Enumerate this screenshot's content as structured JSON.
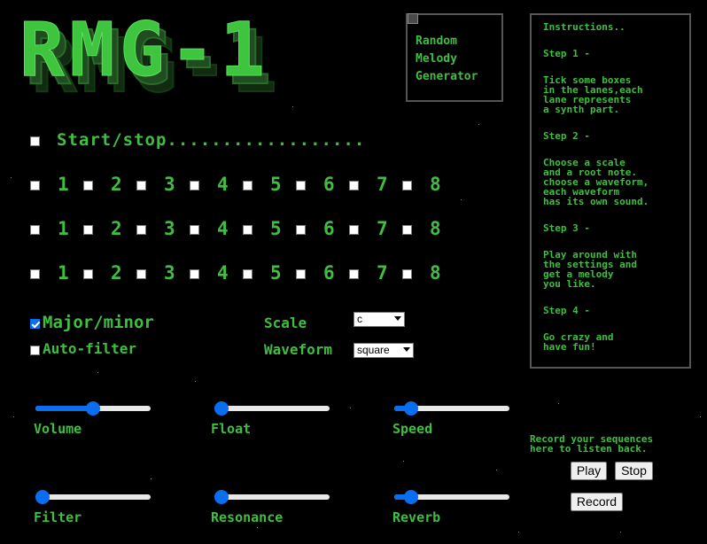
{
  "logo": {
    "text": "RMG-1"
  },
  "title_box": {
    "line1": "Random",
    "line2": "Melody",
    "line3": "Generator"
  },
  "instructions": {
    "heading": "Instructions..",
    "step1_title": "Step 1 -",
    "step1_text": "Tick some boxes\nin the lanes,each\nlane represents\na synth part.",
    "step2_title": "Step 2 -",
    "step2_text": "Choose a scale\nand a root note.\nchoose a waveform,\neach waveform\nhas its own sound.",
    "step3_title": "Step 3 -",
    "step3_text": "Play around with\nthe settings and\nget a melody\nyou like.",
    "step4_title": "Step 4 -",
    "step4_text": "Go crazy and\nhave fun!"
  },
  "start_stop": {
    "label": "Start/stop..................",
    "checked": false
  },
  "lanes": [
    {
      "steps": [
        "1",
        "2",
        "3",
        "4",
        "5",
        "6",
        "7",
        "8"
      ]
    },
    {
      "steps": [
        "1",
        "2",
        "3",
        "4",
        "5",
        "6",
        "7",
        "8"
      ]
    },
    {
      "steps": [
        "1",
        "2",
        "3",
        "4",
        "5",
        "6",
        "7",
        "8"
      ]
    }
  ],
  "options": {
    "major_minor": {
      "label": "Major/minor",
      "checked": true
    },
    "auto_filter": {
      "label": "Auto-filter",
      "checked": false
    },
    "scale": {
      "label": "Scale",
      "value": "c"
    },
    "waveform": {
      "label": "Waveform",
      "value": "square"
    }
  },
  "sliders": {
    "volume": {
      "label": "Volume",
      "value": 0.5
    },
    "float": {
      "label": "Float",
      "value": 0.0
    },
    "speed": {
      "label": "Speed",
      "value": 0.1
    },
    "filter": {
      "label": "Filter",
      "value": 0.0
    },
    "resonance": {
      "label": "Resonance",
      "value": 0.0
    },
    "reverb": {
      "label": "Reverb",
      "value": 0.1
    }
  },
  "recorder": {
    "text_line1": "Record your sequences",
    "text_line2": "here to listen back.",
    "play_label": "Play",
    "stop_label": "Stop",
    "record_label": "Record"
  },
  "colors": {
    "text_green": "#3fbf3f",
    "accent_blue": "#0a6ef0",
    "background": "#000000"
  }
}
